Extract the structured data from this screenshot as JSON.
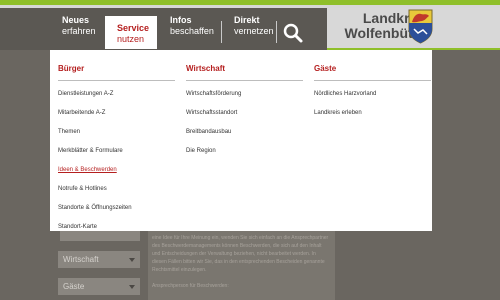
{
  "nav": {
    "items": [
      {
        "title": "Neues",
        "subtitle": "erfahren"
      },
      {
        "title": "Service",
        "subtitle": "nutzen"
      },
      {
        "title": "Infos",
        "subtitle": "beschaffen"
      },
      {
        "title": "Direkt",
        "subtitle": "vernetzen"
      }
    ],
    "search_icon": "search-icon",
    "active_color": "#b51f1f"
  },
  "logo": {
    "line1": "Landkreis",
    "line2": "Wolfenbüttel"
  },
  "menu": {
    "buerger": {
      "heading": "Bürger",
      "items": [
        "Dienstleistungen A-Z",
        "Mitarbeitende A-Z",
        "Themen",
        "Merkblätter & Formulare",
        "Ideen & Beschwerden",
        "Notrufe & Hotlines",
        "Standorte & Öffnungszeiten",
        "Standort-Karte"
      ]
    },
    "wirtschaft": {
      "heading": "Wirtschaft",
      "items": [
        "Wirtschaftsförderung",
        "Wirtschaftsstandort",
        "Breitbandausbau",
        "Die Region"
      ]
    },
    "gaeste": {
      "heading": "Gäste",
      "items": [
        "Nördliches Harzvorland",
        "Landkreis erleben"
      ]
    }
  },
  "background": {
    "sidebar": [
      "Wirtschaft",
      "Gäste"
    ],
    "paragraph1": "eine Idee für Ihre Meinung ein, wenden Sie sich einfach an die Ansprechpartner des Beschwerdemanagements können Beschwerden, die sich auf den Inhalt und Entscheidungen der Verwaltung beziehen, nicht bearbeitet werden. In diesen Fällen bitten wir Sie, das in den entsprechenden Bescheiden genannte Rechtsmittel einzulegen.",
    "paragraph2": "Ansprechperson für Beschwerden:"
  }
}
